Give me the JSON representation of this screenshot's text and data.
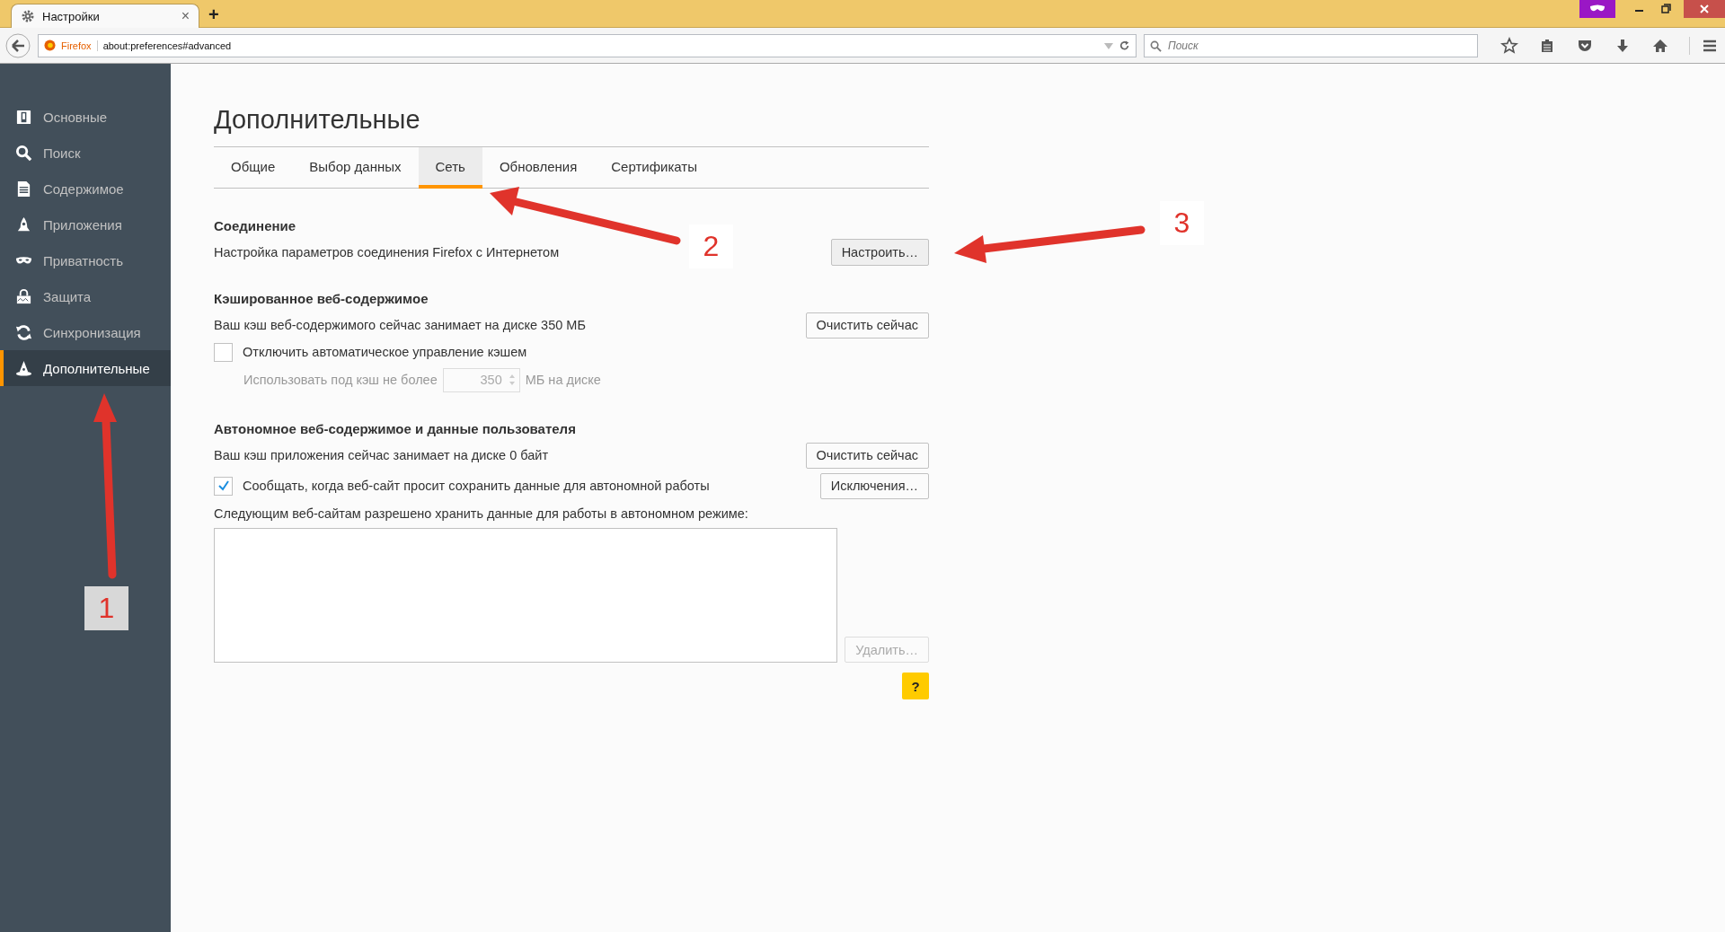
{
  "browser": {
    "tab": {
      "title": "Настройки",
      "close": "×"
    },
    "new_tab": "+",
    "identity": "Firefox",
    "url": "about:preferences#advanced",
    "search": {
      "placeholder": "Поиск"
    }
  },
  "sidebar": {
    "items": [
      {
        "label": "Основные",
        "selected": false
      },
      {
        "label": "Поиск",
        "selected": false
      },
      {
        "label": "Содержимое",
        "selected": false
      },
      {
        "label": "Приложения",
        "selected": false
      },
      {
        "label": "Приватность",
        "selected": false
      },
      {
        "label": "Защита",
        "selected": false
      },
      {
        "label": "Синхронизация",
        "selected": false
      },
      {
        "label": "Дополнительные",
        "selected": true
      }
    ]
  },
  "page": {
    "title": "Дополнительные",
    "tabs": [
      {
        "label": "Общие",
        "selected": false
      },
      {
        "label": "Выбор данных",
        "selected": false
      },
      {
        "label": "Сеть",
        "selected": true
      },
      {
        "label": "Обновления",
        "selected": false
      },
      {
        "label": "Сертификаты",
        "selected": false
      }
    ],
    "connection": {
      "heading": "Соединение",
      "description": "Настройка параметров соединения Firefox с Интернетом",
      "button": "Настроить…"
    },
    "cache": {
      "heading": "Кэшированное веб-содержимое",
      "usage": "Ваш кэш веб-содержимого сейчас занимает на диске 350 МБ",
      "clear_button": "Очистить сейчас",
      "override": {
        "label": "Отключить автоматическое управление кэшем",
        "checked": false
      },
      "limit": {
        "label": "Использовать под кэш не более",
        "value": "350",
        "unit": "МБ на диске"
      }
    },
    "offline": {
      "heading": "Автономное веб-содержимое и данные пользователя",
      "usage": "Ваш кэш приложения сейчас занимает на диске 0 байт",
      "clear_button": "Очистить сейчас",
      "notify": {
        "label": "Сообщать, когда веб-сайт просит сохранить данные для автономной работы",
        "checked": true
      },
      "exceptions_button": "Исключения…",
      "list_label": "Следующим веб-сайтам разрешено хранить данные для работы в автономном режиме:",
      "remove_button": {
        "label": "Удалить…",
        "disabled": true
      }
    },
    "help_button": "?"
  },
  "annotations": [
    {
      "label": "1"
    },
    {
      "label": "2"
    },
    {
      "label": "3"
    }
  ]
}
